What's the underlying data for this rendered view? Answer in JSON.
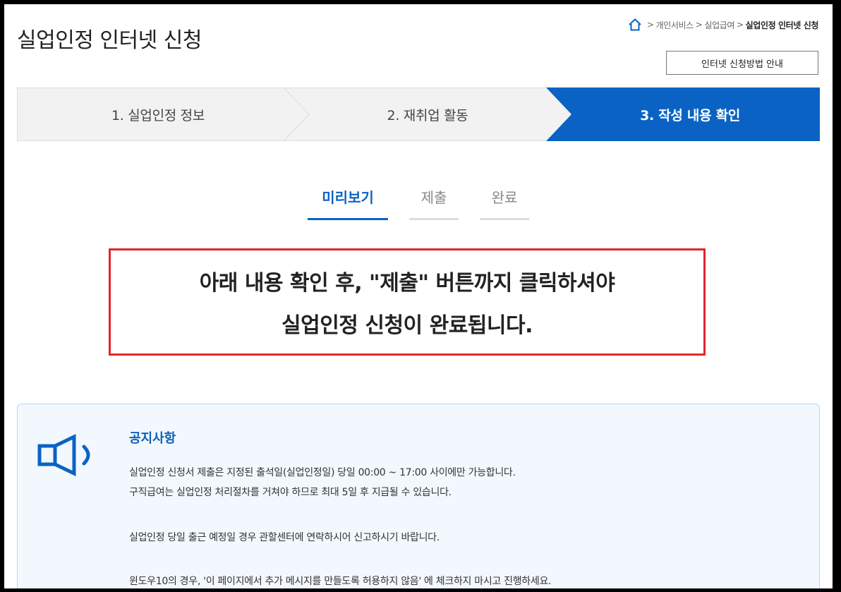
{
  "page": {
    "title": "실업인정 인터넷 신청"
  },
  "breadcrumb": {
    "items": [
      "개인서비스",
      "실업급여"
    ],
    "current": "실업인정 인터넷 신청",
    "separator": ">"
  },
  "guide_button": "인터넷 신청방법 안내",
  "steps": [
    {
      "label": "1. 실업인정 정보",
      "active": false
    },
    {
      "label": "2. 재취업 활동",
      "active": false
    },
    {
      "label": "3. 작성 내용 확인",
      "active": true
    }
  ],
  "subtabs": [
    {
      "label": "미리보기",
      "active": true
    },
    {
      "label": "제출",
      "active": false
    },
    {
      "label": "완료",
      "active": false
    }
  ],
  "alert": {
    "line1": "아래 내용 확인 후, \"제출\" 버튼까지 클릭하셔야",
    "line2": "실업인정 신청이 완료됩니다."
  },
  "notice": {
    "heading": "공지사항",
    "lines": [
      "실업인정 신청서 제출은 지정된 출석일(실업인정일) 당일 00:00 ~ 17:00 사이에만 가능합니다.",
      "구직급여는 실업인정 처리절차를 거쳐야 하므로 최대 5일 후 지급될 수 있습니다.",
      "실업인정 당일 출근 예정일 경우 관할센터에 연락하시어 신고하시기 바랍니다.",
      "윈도우10의 경우, '이 페이지에서 추가 메시지를 만들도록 허용하지 않음' 에 체크하지 마시고 진행하세요."
    ]
  },
  "colors": {
    "primary": "#0a63c4",
    "step_bg": "#f2f2f2",
    "alert_border": "#e2262a",
    "notice_bg": "#f2f8fe"
  },
  "icons": {
    "home": "home-icon",
    "speaker": "speaker-icon"
  }
}
